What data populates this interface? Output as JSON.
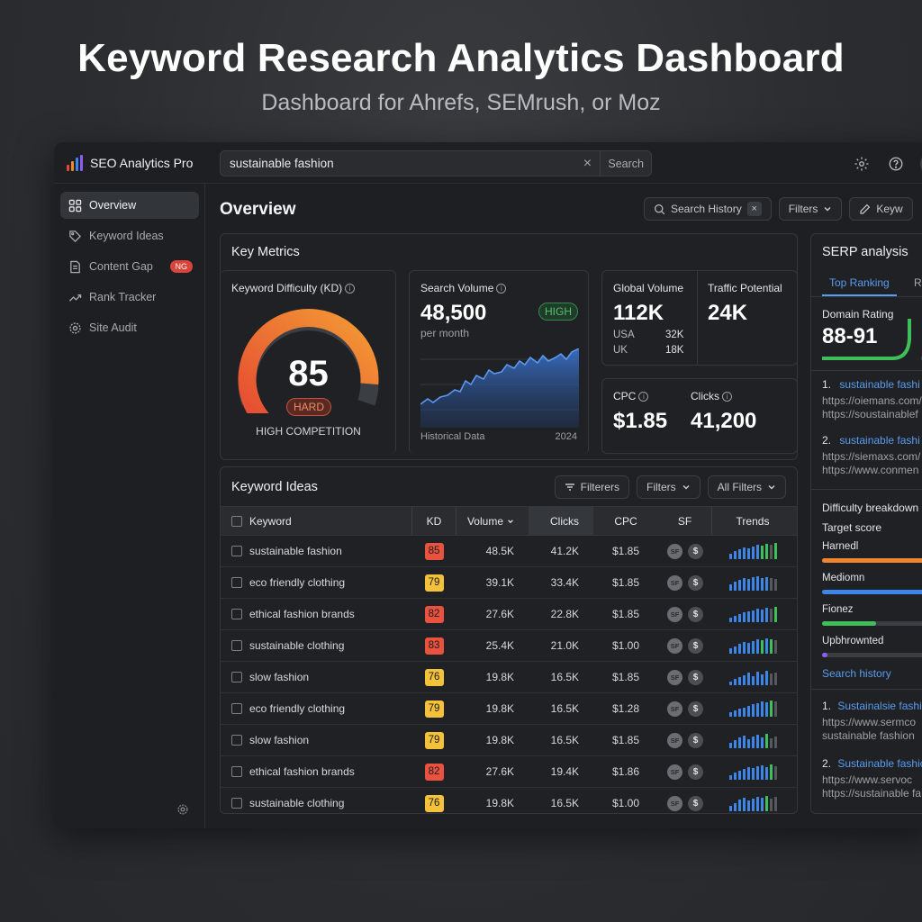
{
  "hero": {
    "title": "Keyword Research Analytics Dashboard",
    "subtitle": "Dashboard for Ahrefs, SEMrush, or Moz"
  },
  "app": {
    "brand": "SEO Analytics Pro",
    "search": {
      "value": "sustainable fashion",
      "button": "Search"
    }
  },
  "sidebar": {
    "items": [
      {
        "label": "Overview",
        "icon": "grid-icon",
        "active": true
      },
      {
        "label": "Keyword Ideas",
        "icon": "tag-icon"
      },
      {
        "label": "Content Gap",
        "icon": "document-icon",
        "badge": "NG"
      },
      {
        "label": "Rank Tracker",
        "icon": "trend-icon"
      },
      {
        "label": "Site Audit",
        "icon": "gear-icon"
      }
    ]
  },
  "main": {
    "title": "Overview",
    "actions": {
      "history": "Search History",
      "filters": "Filters",
      "keyword": "Keyw"
    }
  },
  "metrics": {
    "title": "Key Metrics",
    "kd": {
      "label": "Keyword Difficulty (KD)",
      "value": "85",
      "badge": "HARD",
      "caption": "HIGH COMPETITION",
      "fraction": 0.85
    },
    "volume": {
      "label": "Search Volume",
      "value": "48,500",
      "badge": "HIGH",
      "unit": "per month",
      "footer_left": "Historical Data",
      "footer_right": "2024"
    },
    "global": {
      "label": "Global Volume",
      "value": "112K",
      "rows": [
        {
          "country": "USA",
          "value": "32K"
        },
        {
          "country": "UK",
          "value": "18K"
        }
      ]
    },
    "traffic": {
      "label": "Traffic Potential",
      "value": "24K"
    },
    "cpc": {
      "label": "CPC",
      "value": "$1.85"
    },
    "clicks": {
      "label": "Clicks",
      "value": "41,200"
    }
  },
  "keywords": {
    "title": "Keyword Ideas",
    "buttons": {
      "filterers": "Filterers",
      "filters": "Filters",
      "all": "All Filters"
    },
    "columns": {
      "keyword": "Keyword",
      "kd": "KD",
      "volume": "Volume",
      "clicks": "Clicks",
      "cpc": "CPC",
      "sf": "SF",
      "trends": "Trends"
    },
    "sf_label": "SF",
    "rows": [
      {
        "keyword": "sustainable fashion",
        "kd": "85",
        "kd_level": "red",
        "volume": "48.5K",
        "clicks": "41.2K",
        "cpc": "$1.85",
        "sf2": "$"
      },
      {
        "keyword": "eco friendly clothing",
        "kd": "79",
        "kd_level": "yellow",
        "volume": "39.1K",
        "clicks": "33.4K",
        "cpc": "$1.85",
        "sf2": "$"
      },
      {
        "keyword": "ethical fashion brands",
        "kd": "82",
        "kd_level": "red",
        "volume": "27.6K",
        "clicks": "22.8K",
        "cpc": "$1.85",
        "sf2": "$"
      },
      {
        "keyword": "sustainable clothing",
        "kd": "83",
        "kd_level": "red",
        "volume": "25.4K",
        "clicks": "21.0K",
        "cpc": "$1.00",
        "sf2": "$"
      },
      {
        "keyword": "slow fashion",
        "kd": "76",
        "kd_level": "yellow",
        "volume": "19.8K",
        "clicks": "16.5K",
        "cpc": "$1.85",
        "sf2": "$"
      },
      {
        "keyword": "eco friendly clothing",
        "kd": "79",
        "kd_level": "yellow",
        "volume": "19.8K",
        "clicks": "16.5K",
        "cpc": "$1.28",
        "sf2": "$"
      },
      {
        "keyword": "slow fashion",
        "kd": "79",
        "kd_level": "yellow",
        "volume": "19.8K",
        "clicks": "16.5K",
        "cpc": "$1.85",
        "sf2": "$"
      },
      {
        "keyword": "ethical fashion brands",
        "kd": "82",
        "kd_level": "red",
        "volume": "27.6K",
        "clicks": "19.4K",
        "cpc": "$1.86",
        "sf2": "$"
      },
      {
        "keyword": "sustainable clothing",
        "kd": "76",
        "kd_level": "yellow",
        "volume": "19.8K",
        "clicks": "16.5K",
        "cpc": "$1.00",
        "sf2": "$"
      }
    ]
  },
  "serp": {
    "title": "SERP analysis",
    "tabs": [
      "Top Ranking",
      "Ran"
    ],
    "domain_rating": {
      "label": "Domain Rating",
      "value": "88-91"
    },
    "results": [
      {
        "n": "1.",
        "title": "sustainable fashi",
        "url1": "https://oiemans.com/",
        "url2": "https://soustainablef"
      },
      {
        "n": "2.",
        "title": "sustainable fashi",
        "url1": "https://siemaxs.com/",
        "url2": "https://www.conmen"
      }
    ],
    "difficulty": {
      "title": "Difficulty breakdown",
      "target": "Target score",
      "bars": [
        {
          "label": "Harnedl",
          "color": "#f0872f",
          "fraction": 1.0
        },
        {
          "label": "Mediomn",
          "color": "#3d86e8",
          "fraction": 1.0
        },
        {
          "label": "Fionez",
          "color": "#3fbf5a",
          "fraction": 0.3
        },
        {
          "label": "Upbhrownted",
          "color": "#8b5cf6",
          "fraction": 0.03
        }
      ]
    },
    "history": {
      "title": "Search history",
      "items": [
        {
          "n": "1.",
          "title": "Sustainalsie fashi",
          "url1": "https://www.sermco",
          "url2": "sustainable fashion"
        },
        {
          "n": "2.",
          "title": "Sustainable fashic",
          "url1": "https://www.servoc",
          "url2": "https://sustainable fa"
        }
      ]
    }
  }
}
